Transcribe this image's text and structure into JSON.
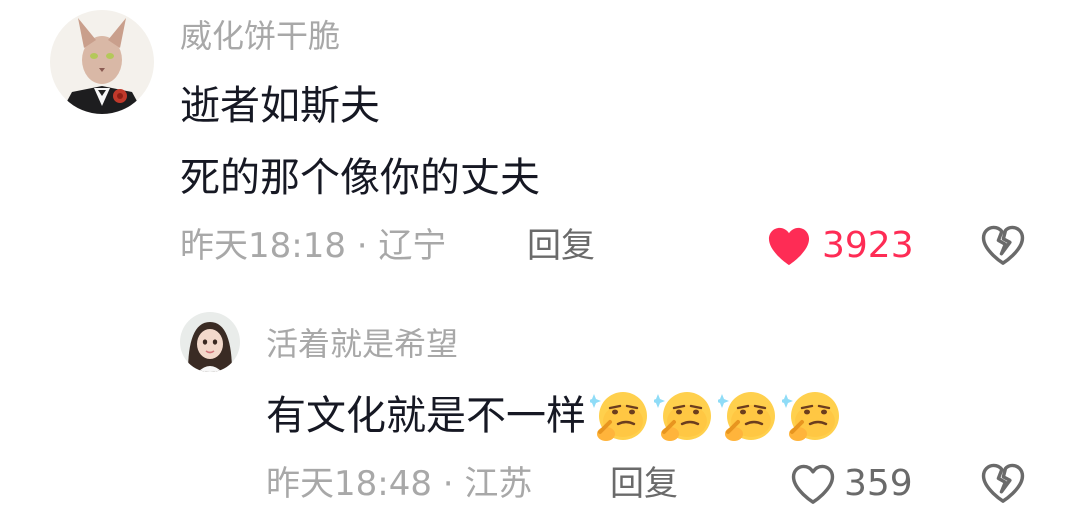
{
  "comment": {
    "username": "威化饼干脆",
    "text_line1": "逝者如斯夫",
    "text_line2": "死的那个像你的丈夫",
    "meta": "昨天18:18 · 辽宁",
    "reply_label": "回复",
    "like_count": "3923",
    "liked": true,
    "like_color": "#fe2c55"
  },
  "reply": {
    "username": "活着就是希望",
    "text": "有文化就是不一样",
    "emojis": [
      "thinking-face-emoji",
      "thinking-face-emoji",
      "thinking-face-emoji",
      "thinking-face-emoji"
    ],
    "meta": "昨天18:48 · 江苏",
    "reply_label": "回复",
    "like_count": "359",
    "liked": false
  },
  "colors": {
    "username": "#a8a8a8",
    "text": "#161823",
    "muted": "#a8a8a8",
    "reply": "#6a6a6a",
    "icon": "#6a6a6a",
    "heart_active": "#fe2c55"
  }
}
